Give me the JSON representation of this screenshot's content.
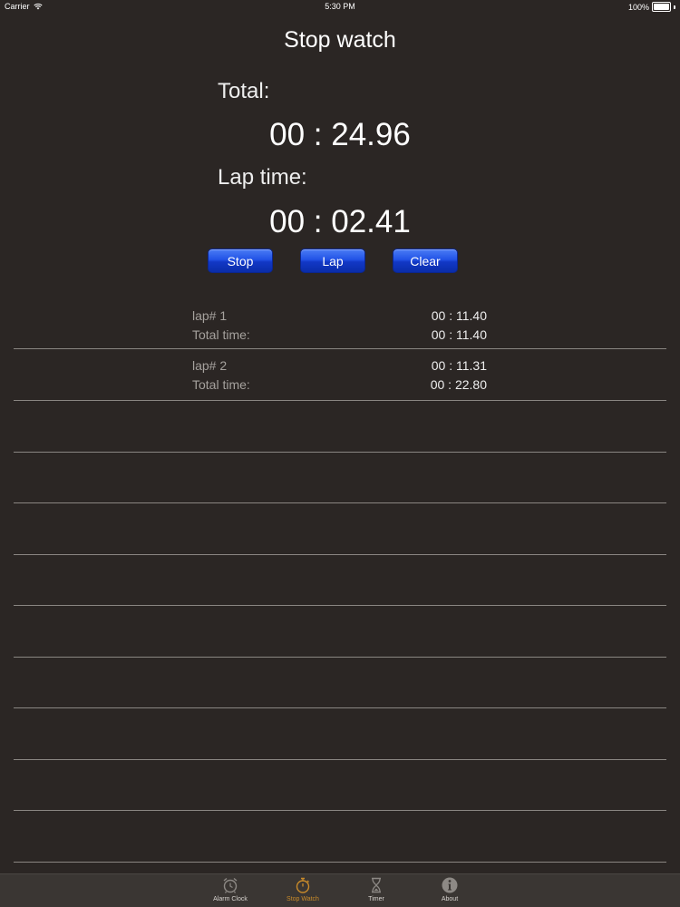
{
  "status_bar": {
    "carrier": "Carrier",
    "time": "5:30 PM",
    "battery": "100%"
  },
  "title": "Stop watch",
  "total": {
    "label": "Total:",
    "value": "00 : 24.96"
  },
  "lap": {
    "label": "Lap time:",
    "value": "00 : 02.41"
  },
  "buttons": {
    "stop": "Stop",
    "lap": "Lap",
    "clear": "Clear"
  },
  "laps": [
    {
      "name": "lap# 1",
      "time": "00 : 11.40",
      "total_label": "Total time:",
      "total_time": "00 : 11.40"
    },
    {
      "name": "lap# 2",
      "time": "00 : 11.31",
      "total_label": "Total time:",
      "total_time": "00 : 22.80"
    }
  ],
  "tabs": [
    {
      "label": "Alarm Clock",
      "icon": "alarm-clock-icon"
    },
    {
      "label": "Stop Watch",
      "icon": "stopwatch-icon",
      "selected": true
    },
    {
      "label": "Timer",
      "icon": "hourglass-icon"
    },
    {
      "label": "About",
      "icon": "info-icon"
    }
  ],
  "colors": {
    "background": "#2b2624",
    "button_blue": "#2152e6",
    "tab_selected": "#c88a2a"
  }
}
